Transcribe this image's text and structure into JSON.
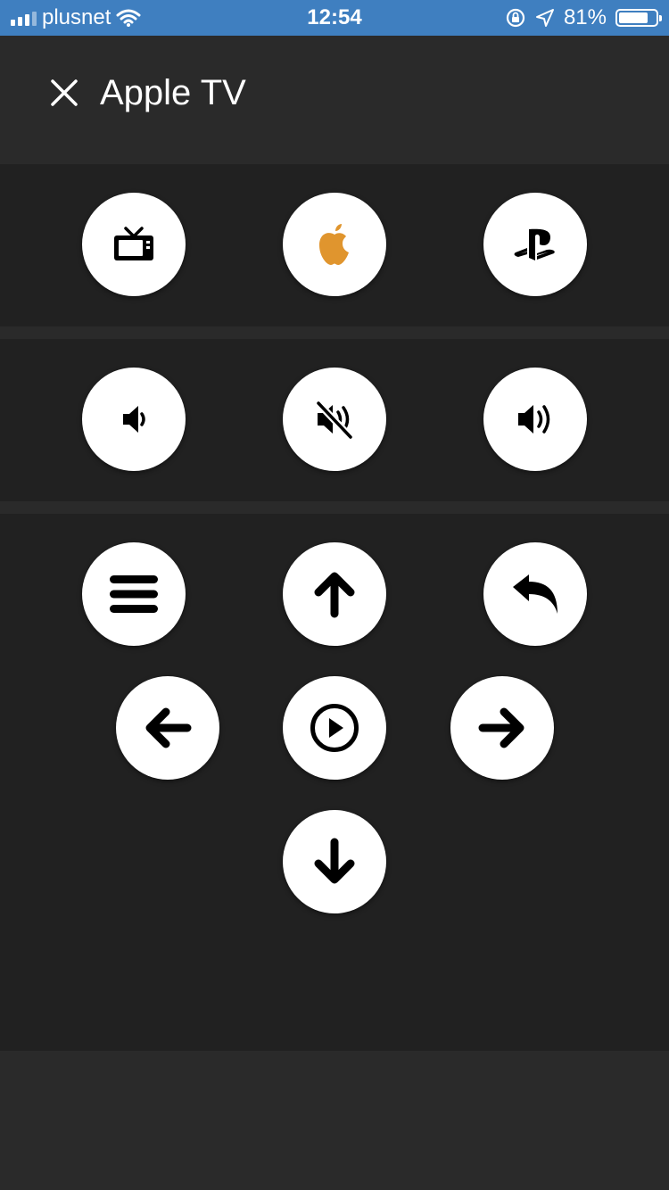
{
  "status": {
    "carrier": "plusnet",
    "time": "12:54",
    "battery": "81%",
    "battery_level": 0.81
  },
  "header": {
    "title": "Apple TV"
  },
  "colors": {
    "status_bar": "#3f7fc0",
    "background": "#2a2a2a",
    "panel": "#212121",
    "button": "#ffffff",
    "apple_accent": "#e0952e"
  },
  "sources": [
    {
      "name": "tv-icon"
    },
    {
      "name": "apple-icon"
    },
    {
      "name": "playstation-icon"
    }
  ],
  "volume": [
    {
      "name": "volume-down-icon"
    },
    {
      "name": "mute-icon"
    },
    {
      "name": "volume-up-icon"
    }
  ],
  "navigation": [
    {
      "name": "menu-icon"
    },
    {
      "name": "arrow-up-icon"
    },
    {
      "name": "back-icon"
    },
    {
      "name": "arrow-left-icon"
    },
    {
      "name": "play-pause-icon"
    },
    {
      "name": "arrow-right-icon"
    },
    {
      "name": "arrow-down-icon"
    }
  ]
}
